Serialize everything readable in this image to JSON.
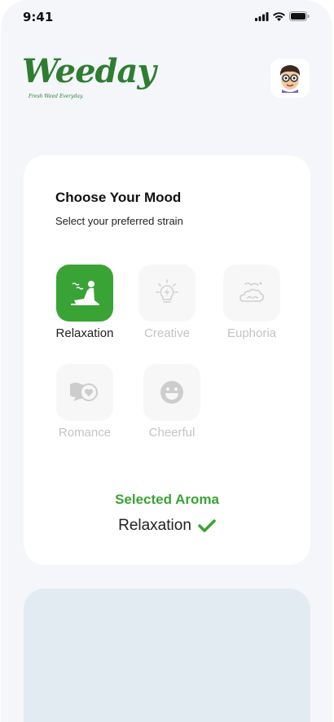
{
  "status_bar": {
    "time": "9:41"
  },
  "brand": {
    "name": "Weeday",
    "tagline": "Fresh Weed Everyday."
  },
  "header": {
    "avatar_icon": "memoji-avatar-icon"
  },
  "mood_card": {
    "title": "Choose Your Mood",
    "subtitle": "Select your preferred strain",
    "moods": [
      {
        "label": "Relaxation",
        "icon": "relaxing-person-icon",
        "selected": true
      },
      {
        "label": "Creative",
        "icon": "lightbulb-icon",
        "selected": false
      },
      {
        "label": "Euphoria",
        "icon": "cloud-bird-icon",
        "selected": false
      },
      {
        "label": "Romance",
        "icon": "chat-heart-icon",
        "selected": false
      },
      {
        "label": "Cheerful",
        "icon": "smiley-icon",
        "selected": false
      }
    ],
    "selected_heading": "Selected Aroma",
    "selected_value": "Relaxation"
  },
  "colors": {
    "accent": "#3aa335",
    "brand": "#2e7d32",
    "background": "#f4f6fa"
  }
}
